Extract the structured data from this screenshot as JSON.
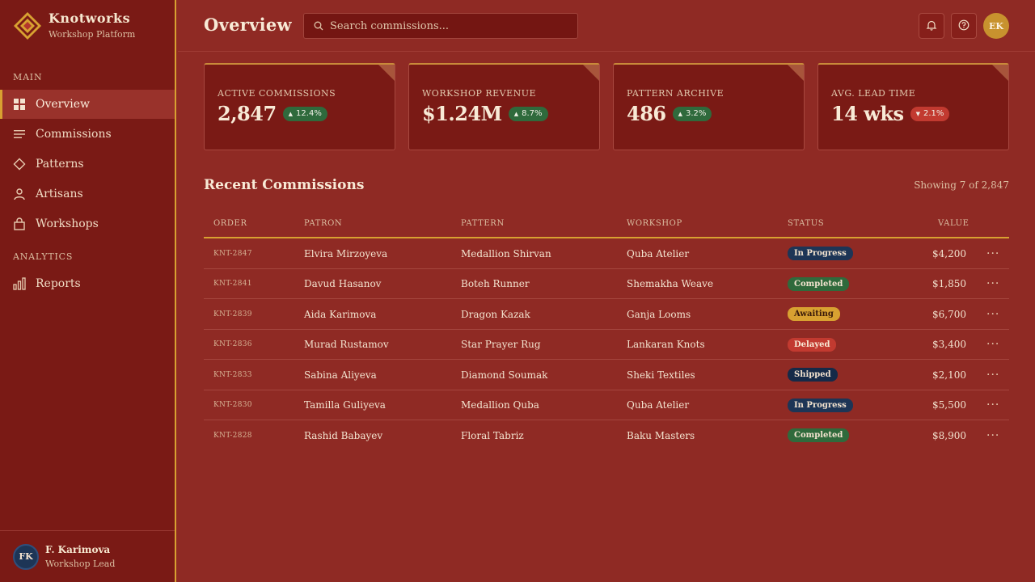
{
  "brand": {
    "name": "Knotworks",
    "subtitle": "Workshop Platform"
  },
  "sidebar": {
    "sections": [
      {
        "label": "Main"
      },
      {
        "label": "Analytics"
      }
    ],
    "items": [
      {
        "label": "Overview",
        "icon": "grid-icon",
        "active": true
      },
      {
        "label": "Commissions",
        "icon": "list-icon",
        "active": false
      },
      {
        "label": "Patterns",
        "icon": "diamond-icon",
        "active": false
      },
      {
        "label": "Artisans",
        "icon": "user-icon",
        "active": false
      },
      {
        "label": "Workshops",
        "icon": "bag-icon",
        "active": false
      },
      {
        "label": "Reports",
        "icon": "bar-chart-icon",
        "active": false
      }
    ],
    "user": {
      "initials": "FK",
      "name": "F. Karimova",
      "role": "Workshop Lead"
    }
  },
  "header": {
    "title": "Overview",
    "search_placeholder": "Search commissions...",
    "avatar_initials": "EK",
    "buttons": [
      "bell-icon",
      "help-icon"
    ]
  },
  "stats": [
    {
      "label": "Active Commissions",
      "value": "2,847",
      "trend": "12.4%",
      "direction": "up"
    },
    {
      "label": "Workshop Revenue",
      "value": "$1.24M",
      "trend": "8.7%",
      "direction": "up"
    },
    {
      "label": "Pattern Archive",
      "value": "486",
      "trend": "3.2%",
      "direction": "up"
    },
    {
      "label": "Avg. Lead Time",
      "value": "14 wks",
      "trend": "2.1%",
      "direction": "down"
    }
  ],
  "table": {
    "title": "Recent Commissions",
    "showing": "Showing 7 of 2,847",
    "columns": [
      "Order",
      "Patron",
      "Pattern",
      "Workshop",
      "Status",
      "Value"
    ],
    "rows": [
      {
        "order": "KNT-2847",
        "patron": "Elvira Mirzoyeva",
        "pattern": "Medallion Shirvan",
        "workshop": "Quba Atelier",
        "status": "In Progress",
        "value": "$4,200"
      },
      {
        "order": "KNT-2841",
        "patron": "Davud Hasanov",
        "pattern": "Boteh Runner",
        "workshop": "Shemakha Weave",
        "status": "Completed",
        "value": "$1,850"
      },
      {
        "order": "KNT-2839",
        "patron": "Aida Karimova",
        "pattern": "Dragon Kazak",
        "workshop": "Ganja Looms",
        "status": "Awaiting",
        "value": "$6,700"
      },
      {
        "order": "KNT-2836",
        "patron": "Murad Rustamov",
        "pattern": "Star Prayer Rug",
        "workshop": "Lankaran Knots",
        "status": "Delayed",
        "value": "$3,400"
      },
      {
        "order": "KNT-2833",
        "patron": "Sabina Aliyeva",
        "pattern": "Diamond Soumak",
        "workshop": "Sheki Textiles",
        "status": "Shipped",
        "value": "$2,100"
      },
      {
        "order": "KNT-2830",
        "patron": "Tamilla Guliyeva",
        "pattern": "Medallion Quba",
        "workshop": "Quba Atelier",
        "status": "In Progress",
        "value": "$5,500"
      },
      {
        "order": "KNT-2828",
        "patron": "Rashid Babayev",
        "pattern": "Floral Tabriz",
        "workshop": "Baku Masters",
        "status": "Completed",
        "value": "$8,900"
      }
    ]
  },
  "status_colors": {
    "In Progress": {
      "bg": "#1d3556",
      "fg": "#f3e3cf"
    },
    "Completed": {
      "bg": "#2f6a3c",
      "fg": "#f3e3cf"
    },
    "Awaiting": {
      "bg": "#d8a131",
      "fg": "#3a1a0a"
    },
    "Delayed": {
      "bg": "#c23a30",
      "fg": "#f8ead6"
    },
    "Shipped": {
      "bg": "#152a48",
      "fg": "#f3e3cf"
    }
  },
  "colors": {
    "accent": "#d8a131",
    "background": "#8f2a24",
    "sidebar": "#7a1a15"
  }
}
